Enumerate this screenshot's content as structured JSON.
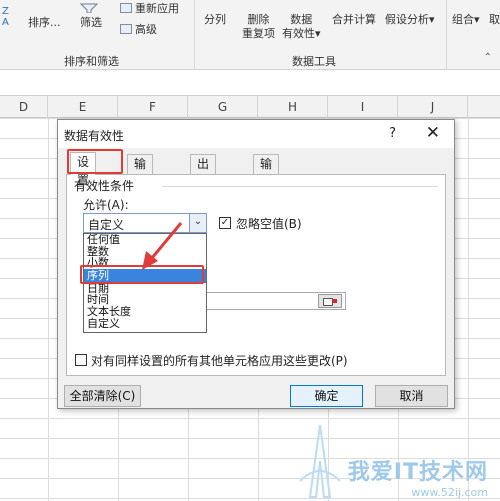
{
  "ribbon": {
    "left_stack_top": "Z",
    "left_stack_bottom": "A",
    "sort_label": "排序...",
    "filter_label": "筛选",
    "reapply_label": "重新应用",
    "advanced_label": "高级",
    "group_sort_filter": "排序和筛选",
    "split_label": "分列",
    "remove_dup_line1": "删除",
    "remove_dup_line2": "重复项",
    "validation_line1": "数据",
    "validation_line2": "有效性",
    "validation_arrow": "▾",
    "consolidate_label": "合并计算",
    "whatif_label": "假设分析",
    "whatif_arrow": "▾",
    "group_data_tools": "数据工具",
    "group_label": "组合",
    "group_arrow": "▾",
    "ungroup_prefix": "取",
    "collapse_glyph": "⌃"
  },
  "sheet": {
    "columns": [
      "D",
      "E",
      "F",
      "G",
      "H",
      "I",
      "J"
    ]
  },
  "dialog": {
    "title": "数据有效性",
    "help": "?",
    "close": "✕",
    "tabs": [
      "设置",
      "输入信息",
      "出错警告",
      "输入法模式"
    ],
    "section_title": "有效性条件",
    "allow_label": "允许(A):",
    "allow_value": "自定义",
    "combo_arrow": "⌄",
    "ignore_blank_label": "忽略空值(B)",
    "ignore_blank_checked": "✓",
    "allow_options": [
      "任何值",
      "整数",
      "小数",
      "序列",
      "日期",
      "时间",
      "文本长度",
      "自定义"
    ],
    "selected_option": "序列",
    "apply_all_label": "对有同样设置的所有其他单元格应用这些更改(P)",
    "clear_all_button": "全部清除(C)",
    "ok_button": "确定",
    "cancel_button": "取消"
  },
  "watermark": {
    "main": "我爱IT技术网",
    "sub": "www.52ij.com"
  },
  "colors": {
    "accent_blue": "#3b84dd",
    "annotation_red": "#e03b3b",
    "ribbon_bg": "#f3f3f3",
    "dialog_bg": "#f0f0f0",
    "watermark": "#9ec9ea"
  }
}
